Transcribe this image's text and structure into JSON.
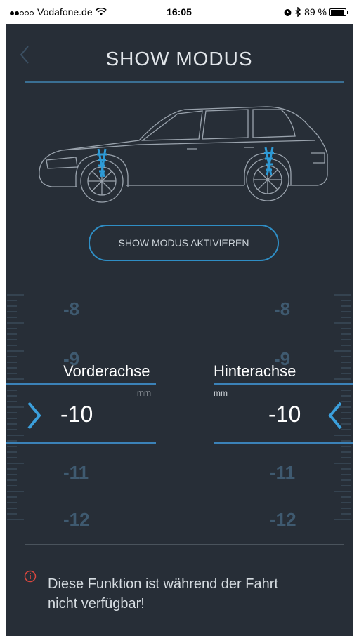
{
  "status_bar": {
    "carrier": "Vodafone.de",
    "time": "16:05",
    "battery_text": "89 %",
    "battery_level": 0.89
  },
  "header": {
    "title": "SHOW MODUS",
    "back_icon": "chevron-left-icon"
  },
  "car_image": {
    "icon": "car-suspension-icon",
    "accent": "#2d9ad6"
  },
  "activate_button": {
    "label": "SHOW MODUS AKTIVIEREN"
  },
  "front_axle": {
    "label": "Vorderachse",
    "unit": "mm",
    "value": "-10",
    "scale": [
      "-8",
      "-9",
      "-11",
      "-12"
    ]
  },
  "rear_axle": {
    "label": "Hinterachse",
    "unit": "mm",
    "value": "-10",
    "scale": [
      "-8",
      "-9",
      "-11",
      "-12"
    ]
  },
  "notice": {
    "icon": "info-icon",
    "text_line1": "Diese Funktion ist während der Fahrt",
    "text_line2": "nicht verfügbar!"
  },
  "colors": {
    "background": "#272e37",
    "accent": "#2f8ec5",
    "warning": "#d9463e"
  }
}
